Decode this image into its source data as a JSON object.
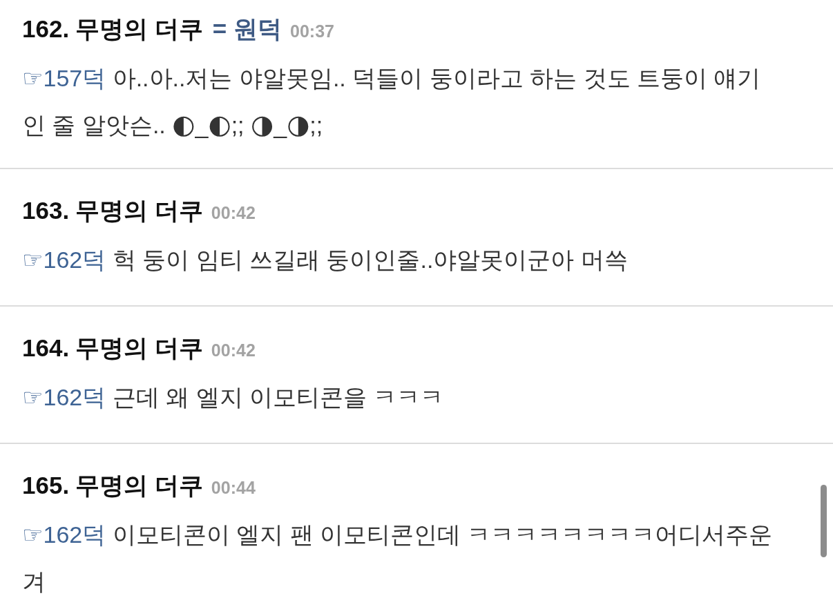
{
  "posts": [
    {
      "number": "162.",
      "author": "무명의 더쿠",
      "author_tag": "= 원덕",
      "time": "00:37",
      "reply_to": "☞157덕",
      "text": "아..아..저는 야알못임.. 덕들이 둥이라고 하는 것도 트둥이 얘기인 줄 알앗슨.. ◐_◐;; ◑_◑;;"
    },
    {
      "number": "163.",
      "author": "무명의 더쿠",
      "time": "00:42",
      "reply_to": "☞162덕",
      "text": "헉 둥이 임티 쓰길래 둥이인줄..야알못이군아 머쓱"
    },
    {
      "number": "164.",
      "author": "무명의 더쿠",
      "time": "00:42",
      "reply_to": "☞162덕",
      "text": "근데 왜 엘지 이모티콘을 ㅋㅋㅋ"
    },
    {
      "number": "165.",
      "author": "무명의 더쿠",
      "time": "00:44",
      "reply_to": "☞162덕",
      "text": "이모티콘이 엘지 팬 이모티콘인데 ㅋㅋㅋㅋㅋㅋㅋㅋ어디서주운겨"
    }
  ]
}
